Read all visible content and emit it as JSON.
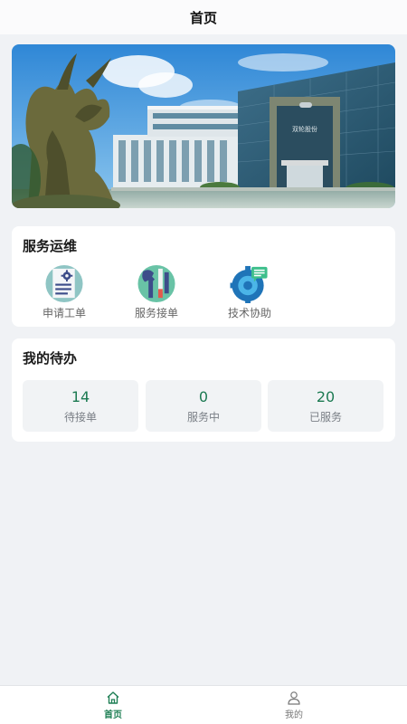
{
  "header": {
    "title": "首页"
  },
  "banner": {
    "building_sign": "双轮股份"
  },
  "service": {
    "title": "服务运维",
    "items": [
      {
        "label": "申请工单",
        "icon": "document-gear-icon"
      },
      {
        "label": "服务接单",
        "icon": "wrench-tools-icon"
      },
      {
        "label": "技术协助",
        "icon": "gear-chat-icon"
      }
    ]
  },
  "todo": {
    "title": "我的待办",
    "stats": [
      {
        "value": "14",
        "label": "待接单"
      },
      {
        "value": "0",
        "label": "服务中"
      },
      {
        "value": "20",
        "label": "已服务"
      }
    ]
  },
  "tabbar": {
    "items": [
      {
        "label": "首页",
        "icon": "home-icon",
        "active": true
      },
      {
        "label": "我的",
        "icon": "user-icon",
        "active": false
      }
    ]
  },
  "colors": {
    "accent": "#1f7f55",
    "background": "#f0f2f5",
    "card": "#ffffff"
  }
}
